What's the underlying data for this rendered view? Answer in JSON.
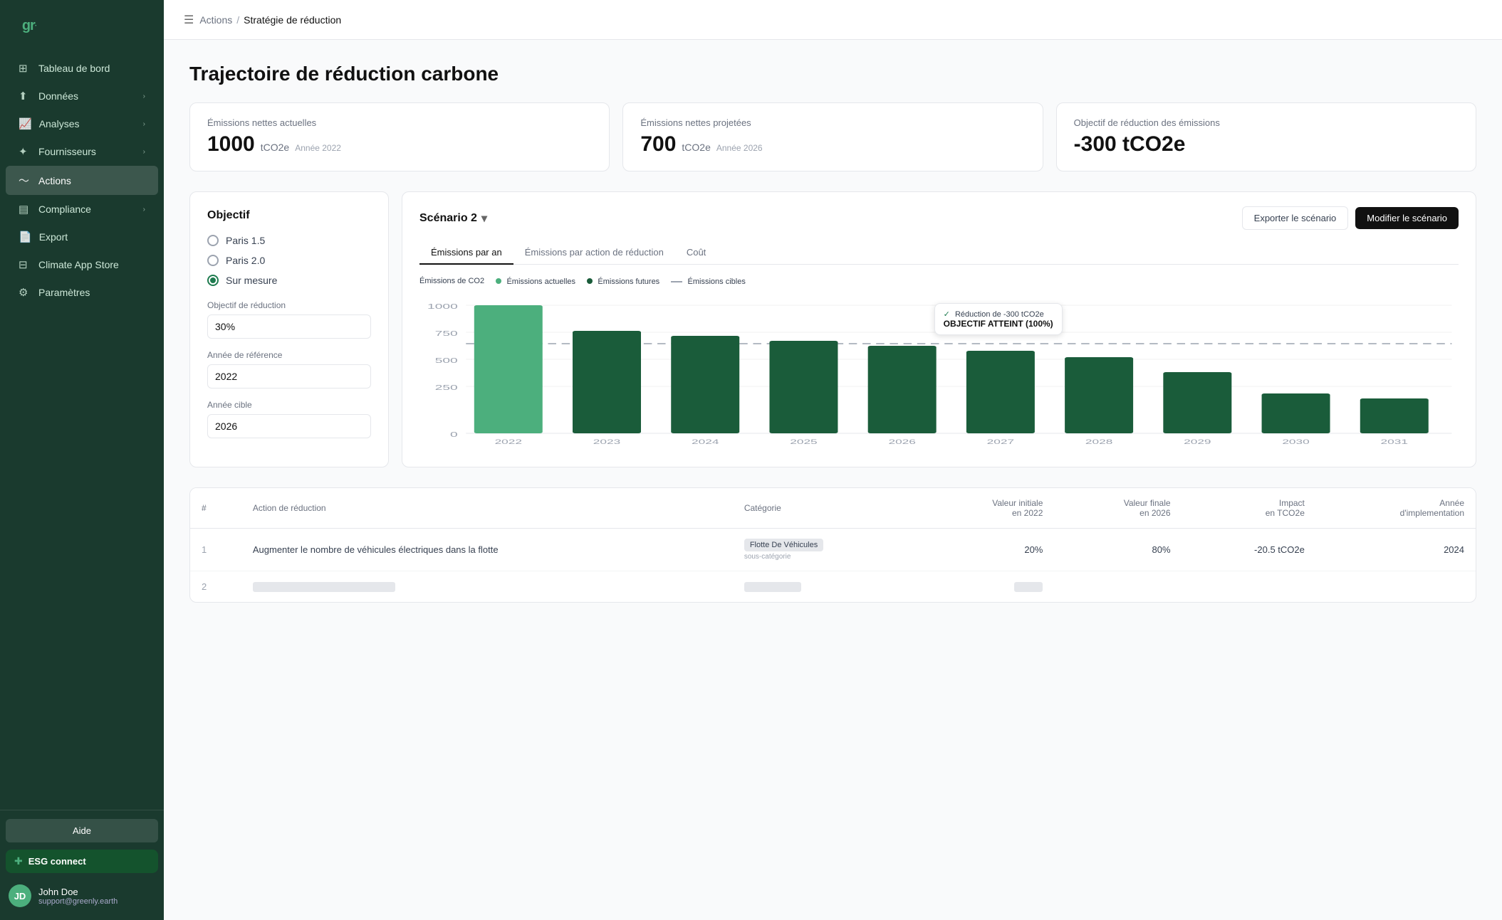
{
  "sidebar": {
    "logo": "gr",
    "items": [
      {
        "id": "tableau",
        "label": "Tableau de bord",
        "icon": "⊞",
        "active": false,
        "hasChevron": false
      },
      {
        "id": "donnees",
        "label": "Données",
        "icon": "↑",
        "active": false,
        "hasChevron": true
      },
      {
        "id": "analyses",
        "label": "Analyses",
        "icon": "📊",
        "active": false,
        "hasChevron": true
      },
      {
        "id": "fournisseurs",
        "label": "Fournisseurs",
        "icon": "✦",
        "active": false,
        "hasChevron": true
      },
      {
        "id": "actions",
        "label": "Actions",
        "icon": "~",
        "active": true,
        "hasChevron": false
      },
      {
        "id": "compliance",
        "label": "Compliance",
        "icon": "▤",
        "active": false,
        "hasChevron": true
      },
      {
        "id": "export",
        "label": "Export",
        "icon": "📄",
        "active": false,
        "hasChevron": false
      },
      {
        "id": "climate",
        "label": "Climate App Store",
        "icon": "⊟",
        "active": false,
        "hasChevron": false
      },
      {
        "id": "parametres",
        "label": "Paramètres",
        "icon": "⚙",
        "active": false,
        "hasChevron": false
      }
    ],
    "help_label": "Aide",
    "esg_label": "ESG connect",
    "user": {
      "name": "John Doe",
      "email": "support@greenly.earth",
      "initials": "JD"
    }
  },
  "breadcrumb": {
    "parent": "Actions",
    "current": "Stratégie de réduction"
  },
  "page": {
    "title": "Trajectoire de réduction carbone"
  },
  "kpis": [
    {
      "label": "Émissions nettes actuelles",
      "value": "1000",
      "unit": "tCO2e",
      "year": "Année 2022"
    },
    {
      "label": "Émissions nettes projetées",
      "value": "700",
      "unit": "tCO2e",
      "year": "Année 2026"
    },
    {
      "label": "Objectif de réduction des émissions",
      "value": "-300 tCO2e",
      "unit": "",
      "year": ""
    }
  ],
  "objectif": {
    "title": "Objectif",
    "options": [
      {
        "id": "paris15",
        "label": "Paris 1.5",
        "selected": false
      },
      {
        "id": "paris20",
        "label": "Paris 2.0",
        "selected": false
      },
      {
        "id": "surMesure",
        "label": "Sur mesure",
        "selected": true
      }
    ],
    "fields": [
      {
        "label": "Objectif de réduction",
        "value": "30%",
        "id": "reduction"
      },
      {
        "label": "Année de référence",
        "value": "2022",
        "id": "anneeRef"
      },
      {
        "label": "Année cible",
        "value": "2026",
        "id": "anneeCible"
      }
    ]
  },
  "scenario": {
    "title": "Scénario 2",
    "export_label": "Exporter le scénario",
    "modify_label": "Modifier le scénario",
    "tabs": [
      {
        "id": "emissionsParAn",
        "label": "Émissions par an",
        "active": true
      },
      {
        "id": "emissionsParAction",
        "label": "Émissions par action de réduction",
        "active": false
      },
      {
        "id": "cout",
        "label": "Coût",
        "active": false
      }
    ],
    "chart": {
      "legend": [
        {
          "label": "Émissions de CO2",
          "type": "text"
        },
        {
          "label": "Émissions actuelles",
          "color": "#4caf7d",
          "type": "dot"
        },
        {
          "label": "Émissions futures",
          "color": "#1a5c3a",
          "type": "dot"
        },
        {
          "label": "Émissions cibles",
          "color": "#9ca3af",
          "type": "dashed"
        }
      ],
      "tooltip": {
        "line1": "Réduction de -300 tCO2e",
        "line2": "OBJECTIF ATTEINT (100%)"
      },
      "years": [
        "2022",
        "2023",
        "2024",
        "2025",
        "2026",
        "2027",
        "2028",
        "2029",
        "2030",
        "2031"
      ],
      "bars": [
        {
          "year": "2022",
          "value": 1000,
          "color": "#4caf7d"
        },
        {
          "year": "2023",
          "value": 800,
          "color": "#1a5c3a"
        },
        {
          "year": "2024",
          "value": 760,
          "color": "#1a5c3a"
        },
        {
          "year": "2025",
          "value": 720,
          "color": "#1a5c3a"
        },
        {
          "year": "2026",
          "value": 680,
          "color": "#1a5c3a"
        },
        {
          "year": "2027",
          "value": 640,
          "color": "#1a5c3a"
        },
        {
          "year": "2028",
          "value": 590,
          "color": "#1a5c3a"
        },
        {
          "year": "2029",
          "value": 480,
          "color": "#1a5c3a"
        },
        {
          "year": "2030",
          "value": 310,
          "color": "#1a5c3a"
        },
        {
          "year": "2031",
          "value": 270,
          "color": "#1a5c3a"
        }
      ],
      "targetLine": 700,
      "maxValue": 1000,
      "yLabels": [
        "1000",
        "750",
        "500",
        "250",
        "0"
      ]
    }
  },
  "table": {
    "columns": [
      {
        "id": "num",
        "label": "#"
      },
      {
        "id": "action",
        "label": "Action de réduction"
      },
      {
        "id": "categorie",
        "label": "Catégorie"
      },
      {
        "id": "valeurInitiale",
        "label": "Valeur initiale\nen 2022"
      },
      {
        "id": "valeurFinale",
        "label": "Valeur finale\nen 2026"
      },
      {
        "id": "impact",
        "label": "Impact\nen TCO2e"
      },
      {
        "id": "annee",
        "label": "Année\nd'implementation"
      }
    ],
    "rows": [
      {
        "num": "1",
        "action": "Augmenter le nombre de véhicules électriques dans la flotte",
        "categorie": "Flotte De Véhicules",
        "sous_categorie": "sous-catégorie",
        "valeurInitiale": "20%",
        "valeurFinale": "80%",
        "impact": "-20.5 tCO2e",
        "annee": "2024"
      },
      {
        "num": "2",
        "action": "",
        "categorie": "",
        "sous_categorie": "",
        "valeurInitiale": "",
        "valeurFinale": "",
        "impact": "",
        "annee": ""
      }
    ]
  }
}
